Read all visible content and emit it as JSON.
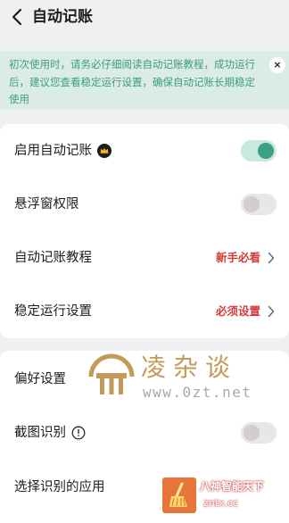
{
  "header": {
    "back_icon": "chevron-left-icon",
    "title": "自动记账"
  },
  "notice": {
    "text": "初次使用时，请务必仔细阅读自动记账教程，成功运行后，建议您查看稳定运行设置，确保自动记账长期稳定使用",
    "close_label": "×",
    "background": "#dbece6",
    "text_color": "#3b9c83"
  },
  "settings_main": {
    "enable_auto": {
      "label": "启用自动记账",
      "badge_icon": "crown-icon",
      "toggle": "on"
    },
    "floating_permission": {
      "label": "悬浮窗权限",
      "toggle": "off"
    },
    "tutorial": {
      "label": "自动记账教程",
      "value": "新手必看"
    },
    "stable_settings": {
      "label": "稳定运行设置",
      "value": "必须设置"
    }
  },
  "settings_pref": {
    "preferences": {
      "label": "偏好设置"
    },
    "screenshot_recognition": {
      "label": "截图识别",
      "info_icon": "info-icon",
      "toggle": "off"
    },
    "select_apps": {
      "label": "选择识别的应用"
    }
  },
  "watermarks": {
    "site_name": "凌杂谈",
    "site_url": "www.0zt.net",
    "badge_title": "八神智能天下",
    "badge_url": "zntx.cc"
  },
  "colors": {
    "accent": "#3aa283",
    "warning": "#d23a3a",
    "background": "#eff0f2"
  }
}
